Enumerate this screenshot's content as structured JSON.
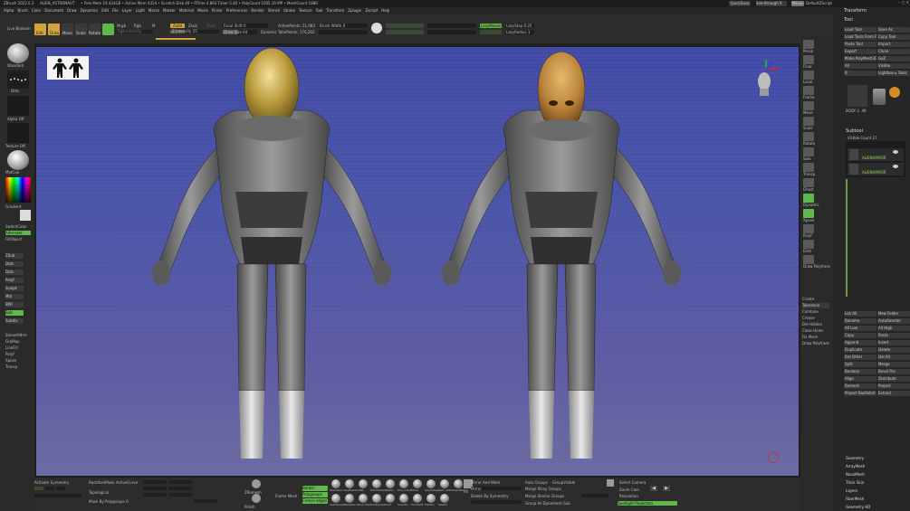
{
  "titlebar": {
    "app": "ZBrush 2022.0.3",
    "doc": "ALIEN_ASTRONAUT",
    "mem": "• Free Mem 19.424GB • Active Mem 4314 • Scratch Disk 49 • RTime 4.863 Timer 5.40 • PolyCount 1005.16 MP • MeshCount 1880",
    "quicksave": "QuickSave",
    "seethrough": "See-through 0",
    "menus_btn": "Menus",
    "default_script": "DefaultZScript"
  },
  "menubar": [
    "Alpha",
    "Brush",
    "Color",
    "Document",
    "Draw",
    "Dynamics",
    "Edit",
    "File",
    "Layer",
    "Light",
    "Macro",
    "Marker",
    "Material",
    "Movie",
    "Picker",
    "Preferences",
    "Render",
    "Stencil",
    "Stroke",
    "Texture",
    "Tool",
    "Transform",
    "Zplugin",
    "Zscript",
    "Help"
  ],
  "toolbar": {
    "lightbox": "Live Boolean",
    "edit": "Edit",
    "draw": "Draw",
    "move": "Move",
    "scale": "Scale",
    "rotate": "Rotate",
    "mrgb": "Mrgb",
    "rgb": "Rgb",
    "m": "M",
    "zadd": "Zadd",
    "zsub": "Zsub",
    "zcut": "Zcut",
    "rgb_intensity": "Rgb Intensity",
    "z_intensity": "Z Intensity 25",
    "focal_shift": "Focal Shift 0",
    "draw_size": "Draw Size 64",
    "dynamic": "Dynamic",
    "active_points": "ActivePoints: 21,083",
    "total_points": "TotalPoints: 176,262",
    "brush_width": "Brush Width 0",
    "lazymouse": "LazyMouse",
    "lazystep": "LazyStep 0.25",
    "lazyradius": "LazyRadius 1"
  },
  "left_shelf": {
    "labels": [
      "Standard",
      "Dots",
      "Alpha Off",
      "Texture Off",
      "MatCap",
      "Gradient",
      "SwitchColor",
      "Alternate",
      "FillObject"
    ],
    "toggles": [
      "ZSub",
      "Dots",
      "Dots",
      "PolyF",
      "Sculpt",
      "Mid",
      "BPR",
      "Sub",
      "Subdiv"
    ],
    "bottom": [
      "SmoothNrm",
      "GrpMap",
      "LineFill",
      "PolyF",
      "Xpose",
      "Transp"
    ]
  },
  "right_tray": {
    "labels": [
      "Persp",
      "Floor",
      "Local",
      "Frame",
      "Move",
      "Scale",
      "Rotate",
      "Solo",
      "Transp",
      "Ghost",
      "Dynamic",
      "Xpose",
      "PolyF",
      "Dots",
      "Draw Polyframe"
    ],
    "extras": [
      "Create",
      "Tolerance",
      "Combine",
      "Crease",
      "Del Hidden",
      "Close Holes",
      "Fix Mesh",
      "Draw Polyframe"
    ]
  },
  "tool_panel": {
    "title": "Transform",
    "section": "Tool",
    "buttons": [
      "Load Tool",
      "Save As",
      "Load Tools From Project",
      "Copy Tool",
      "Paste Tool",
      "Import",
      "Export",
      "Clone",
      "Make PolyMesh3D",
      "GoZ",
      "All",
      "Visible",
      "R",
      "Lightbox ▸ Tools"
    ],
    "tool_name": "BODY 2. 49",
    "subtool_header": "Subtool",
    "visible_count": "Visible Count 27",
    "subtools": [
      "ALIENARMOR",
      "ALIENARMOR"
    ],
    "list_ops": [
      "List All",
      "New Folder",
      "Rename",
      "AutoReorder",
      "All Low",
      "All High",
      "Copy",
      "Paste",
      "Append",
      "Insert",
      "Duplicate",
      "Delete",
      "Del Other",
      "Del All",
      "Split",
      "Merge",
      "Boolean",
      "Bevel Pro",
      "Align",
      "Distribute",
      "Remesh",
      "Project",
      "Project BasRelief",
      "Extract"
    ],
    "sections": [
      "Geometry",
      "ArrayMesh",
      "NanoMesh",
      "Thick Skin",
      "Layers",
      "FiberMesh",
      "Geometry HD"
    ]
  },
  "bottom_bar": {
    "activate_symmetry": "Activate Symmetry",
    "backface": "BackfaceMask",
    "active_curve": "ActiveCurve",
    "topological": "Topological",
    "mask_by_polygroups": "Mask By Polygroups 0",
    "brushes": [
      "Standard",
      "ClayBuildup",
      "Inflat",
      "Damstandard",
      "hPolish",
      "Orb_Cracks",
      "Move",
      "ClayTubes",
      "Dam_Standard",
      "SelectRect",
      "SelectLasso",
      "ZModeler",
      "Move Topological",
      "TrimDynamic",
      "Pinch",
      "Smooth",
      "FormSoft",
      "Flatten",
      "Slash3"
    ],
    "curve_modes": [
      "Border",
      "Polygroups",
      "Crease edges"
    ],
    "mirror_weld": "Mirror And Weld",
    "mirror": "Mirror",
    "delete_by_symmetry": "Delete By Symmetry",
    "auto_groups": "Auto Groups",
    "group_visible": "GroupVisible",
    "merge_stray": "Merge Stray Groups",
    "merge_similar": "Merge Similar Groups",
    "group_as_dynamesh": "Group As Dynamesh Sub",
    "select_camera": "Select Camera",
    "zoom_cam": "Zoom Cam",
    "resolution": "Resolution",
    "spotlight_projection": "Spotlight Projection",
    "zremesh": "ZRemesh",
    "frame_mesh": "Frame Mesh",
    "polish": "Polish",
    "fill": "Fill"
  },
  "colors": {
    "accent": "#d0a43b",
    "green": "#5fb84a",
    "bg": "#2b2b2b",
    "canvas_top": "#3f49a6",
    "canvas_bottom": "#6a6aa2"
  }
}
